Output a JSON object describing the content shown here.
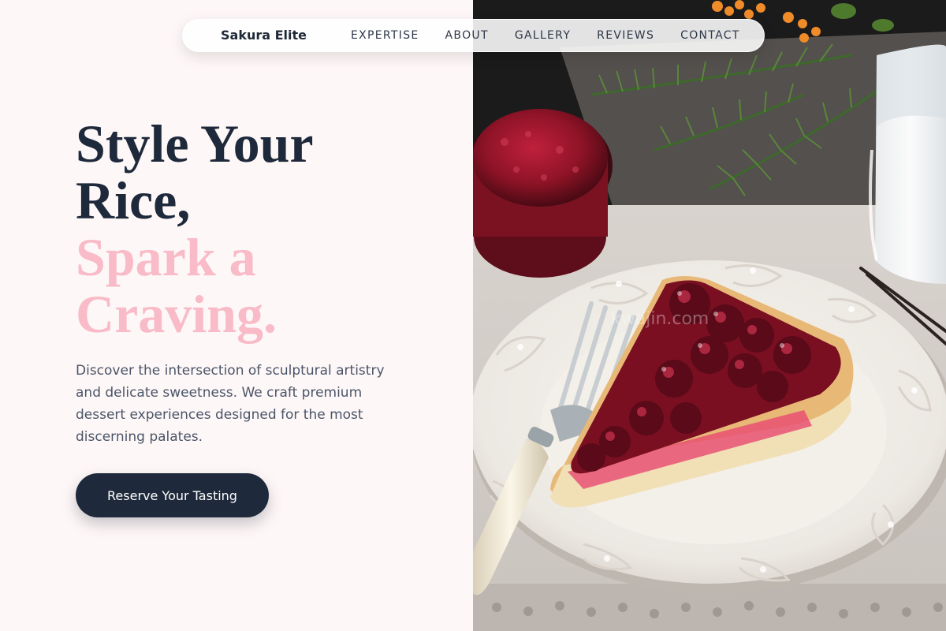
{
  "brand": "Sakura Elite",
  "nav": {
    "items": [
      {
        "label": "EXPERTISE"
      },
      {
        "label": "ABOUT"
      },
      {
        "label": "GALLERY"
      },
      {
        "label": "REVIEWS"
      },
      {
        "label": "CONTACT"
      }
    ]
  },
  "hero": {
    "title_line1": "Style Your",
    "title_line2": "Rice,",
    "title_line3": "Spark a",
    "title_line4": "Craving.",
    "description": "Discover the intersection of sculptural artistry and delicate sweetness. We craft premium dessert experiences designed for the most discerning palates.",
    "cta_label": "Reserve Your Tasting"
  },
  "image": {
    "subject": "cherry tart slice on white ornate plate with fork, jam bowl, milk glass and pine branches",
    "watermark": "kwajin.com"
  },
  "colors": {
    "dark_navy": "#1e293b",
    "pink_accent": "#f8bbc7",
    "background": "#fef7f7",
    "body_text": "#4a5568"
  }
}
